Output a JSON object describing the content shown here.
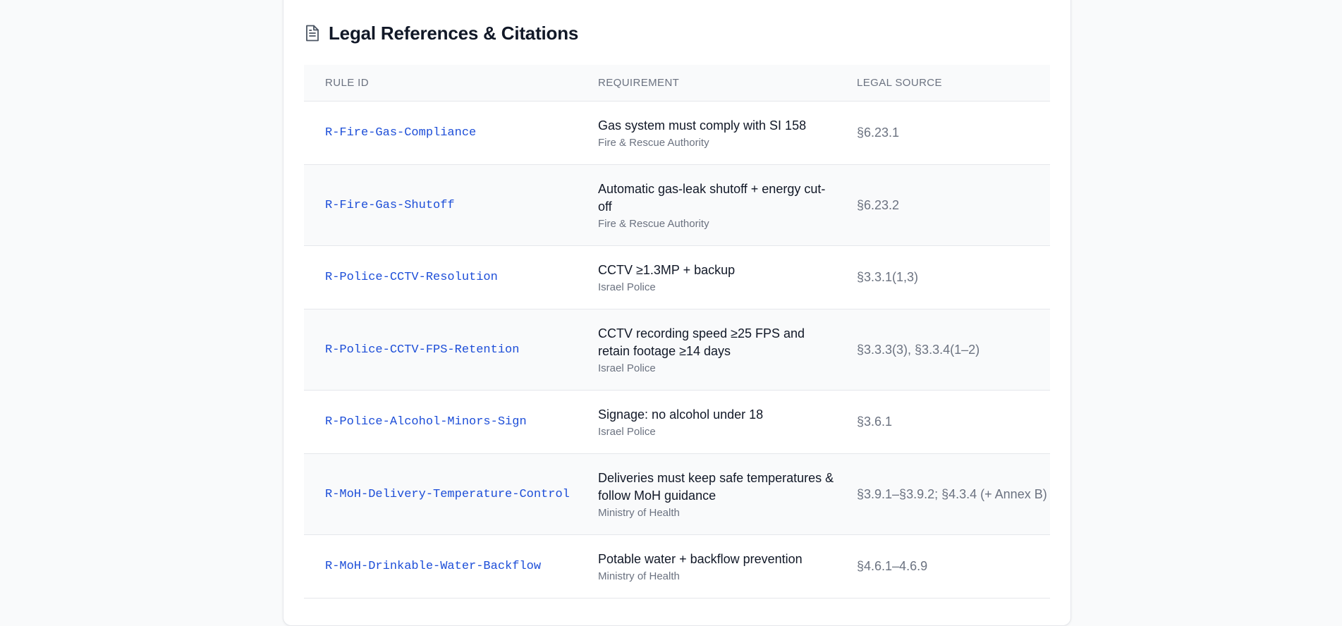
{
  "header": {
    "title": "Legal References & Citations",
    "icon": "document-icon"
  },
  "table": {
    "columns": [
      "RULE ID",
      "REQUIREMENT",
      "LEGAL SOURCE"
    ],
    "rows": [
      {
        "rule_id": "R-Fire-Gas-Compliance",
        "requirement": "Gas system must comply with SI 158",
        "authority": "Fire & Rescue Authority",
        "source": "§6.23.1"
      },
      {
        "rule_id": "R-Fire-Gas-Shutoff",
        "requirement": "Automatic gas-leak shutoff + energy cut-off",
        "authority": "Fire & Rescue Authority",
        "source": "§6.23.2"
      },
      {
        "rule_id": "R-Police-CCTV-Resolution",
        "requirement": "CCTV ≥1.3MP + backup",
        "authority": "Israel Police",
        "source": "§3.3.1(1,3)"
      },
      {
        "rule_id": "R-Police-CCTV-FPS-Retention",
        "requirement": "CCTV recording speed ≥25 FPS and retain footage ≥14 days",
        "authority": "Israel Police",
        "source": "§3.3.3(3), §3.3.4(1–2)"
      },
      {
        "rule_id": "R-Police-Alcohol-Minors-Sign",
        "requirement": "Signage: no alcohol under 18",
        "authority": "Israel Police",
        "source": "§3.6.1"
      },
      {
        "rule_id": "R-MoH-Delivery-Temperature-Control",
        "requirement": "Deliveries must keep safe temperatures & follow MoH guidance",
        "authority": "Ministry of Health",
        "source": "§3.9.1–§3.9.2; §4.3.4 (+ Annex B)"
      },
      {
        "rule_id": "R-MoH-Drinkable-Water-Backflow",
        "requirement": "Potable water + backflow prevention",
        "authority": "Ministry of Health",
        "source": "§4.6.1–4.6.9"
      }
    ]
  },
  "colors": {
    "link": "#1d4ed8",
    "muted": "#6b7280",
    "stripe": "#f9fafb",
    "border": "#e5e7eb"
  }
}
